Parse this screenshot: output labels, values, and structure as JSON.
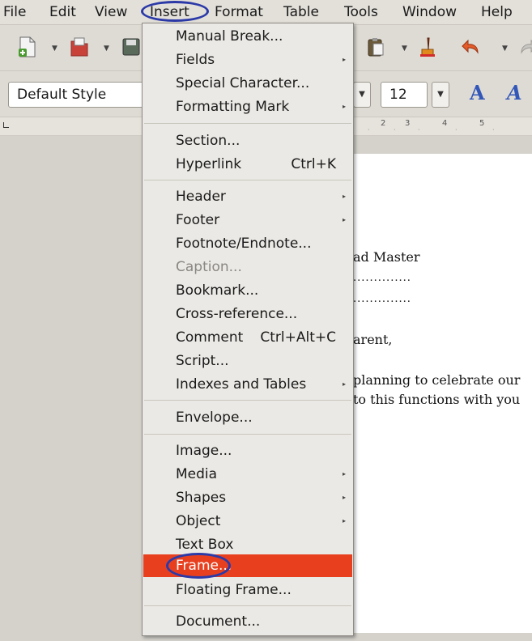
{
  "menubar": {
    "items": [
      {
        "id": "file",
        "label": "File"
      },
      {
        "id": "edit",
        "label": "Edit"
      },
      {
        "id": "view",
        "label": "View"
      },
      {
        "id": "insert",
        "label": "Insert"
      },
      {
        "id": "format",
        "label": "Format"
      },
      {
        "id": "table",
        "label": "Table"
      },
      {
        "id": "tools",
        "label": "Tools"
      },
      {
        "id": "window",
        "label": "Window"
      },
      {
        "id": "help",
        "label": "Help"
      }
    ]
  },
  "toolbar2": {
    "paragraph_style": "Default Style",
    "font_size": "12",
    "bold_glyph": "A",
    "italic_glyph": "A"
  },
  "ruler": {
    "marks": [
      "2",
      "3",
      "4",
      "5"
    ]
  },
  "document": {
    "lines": [
      "ad Master",
      "..............",
      "..............",
      "arent,",
      "planning to celebrate our",
      "to this functions with you"
    ]
  },
  "insert_menu": {
    "items": [
      {
        "label": "Manual Break...",
        "shortcut": "",
        "submenu": false
      },
      {
        "label": "Fields",
        "shortcut": "",
        "submenu": true
      },
      {
        "label": "Special Character...",
        "shortcut": "",
        "submenu": false
      },
      {
        "label": "Formatting Mark",
        "shortcut": "",
        "submenu": true
      },
      {
        "label": "Section...",
        "shortcut": "",
        "submenu": false
      },
      {
        "label": "Hyperlink",
        "shortcut": "Ctrl+K",
        "submenu": false
      },
      {
        "label": "Header",
        "shortcut": "",
        "submenu": true
      },
      {
        "label": "Footer",
        "shortcut": "",
        "submenu": true
      },
      {
        "label": "Footnote/Endnote...",
        "shortcut": "",
        "submenu": false
      },
      {
        "label": "Caption...",
        "shortcut": "",
        "submenu": false,
        "disabled": true
      },
      {
        "label": "Bookmark...",
        "shortcut": "",
        "submenu": false
      },
      {
        "label": "Cross-reference...",
        "shortcut": "",
        "submenu": false
      },
      {
        "label": "Comment",
        "shortcut": "Ctrl+Alt+C",
        "submenu": false
      },
      {
        "label": "Script...",
        "shortcut": "",
        "submenu": false
      },
      {
        "label": "Indexes and Tables",
        "shortcut": "",
        "submenu": true
      },
      {
        "label": "Envelope...",
        "shortcut": "",
        "submenu": false
      },
      {
        "label": "Image...",
        "shortcut": "",
        "submenu": false
      },
      {
        "label": "Media",
        "shortcut": "",
        "submenu": true
      },
      {
        "label": "Shapes",
        "shortcut": "",
        "submenu": true
      },
      {
        "label": "Object",
        "shortcut": "",
        "submenu": true
      },
      {
        "label": "Text Box",
        "shortcut": "",
        "submenu": false
      },
      {
        "label": "Frame...",
        "shortcut": "",
        "submenu": false,
        "highlighted": true
      },
      {
        "label": "Floating Frame...",
        "shortcut": "",
        "submenu": false
      },
      {
        "label": "Document...",
        "shortcut": "",
        "submenu": false
      }
    ],
    "submenu_glyph": "▸"
  },
  "colors": {
    "highlight": "#e8401f",
    "annotation_ring": "#2c3aa8",
    "menu_bg": "#ebe9e5",
    "toolbar_bg": "#dedbd5"
  }
}
